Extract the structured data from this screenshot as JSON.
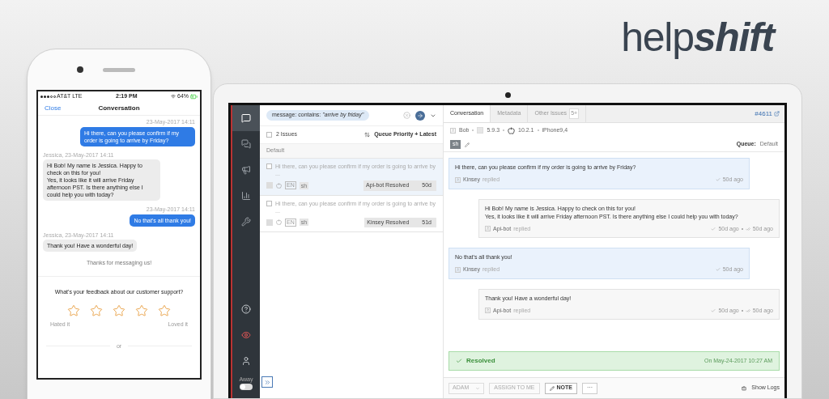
{
  "brand": {
    "logo_light": "help",
    "logo_bold": "shift"
  },
  "phone": {
    "status_bar": {
      "carrier": "AT&T  LTE",
      "time": "2:19 PM",
      "battery": "64%"
    },
    "nav": {
      "close": "Close",
      "title": "Conversation"
    },
    "messages": [
      {
        "kind": "sent",
        "meta": "23-May-2017 14:11",
        "text": "Hi there, can you please confirm if my order is going to arrive by Friday?"
      },
      {
        "kind": "received",
        "meta": "Jessica, 23-May-2017 14:11",
        "text": "Hi Bob! My name is Jessica. Happy to check on this for you!\nYes, it looks like it will arrive Friday afternoon PST.  Is there anything else I could help you with today?"
      },
      {
        "kind": "sent",
        "meta": "23-May-2017 14:11",
        "text": "No that's all thank you!"
      },
      {
        "kind": "received",
        "meta": "Jessica, 23-May-2017 14:11",
        "text": "Thank you! Have a wonderful day!"
      }
    ],
    "footer_note": "Thanks for messaging us!",
    "feedback": {
      "question": "What's your feedback about our customer support?",
      "stars": 0,
      "low_label": "Hated it",
      "high_label": "Loved it"
    },
    "divider_text": "or"
  },
  "app": {
    "sidebar": {
      "top_items": [
        {
          "selected": true
        },
        {
          "selected": false
        },
        {
          "selected": false
        },
        {
          "selected": false
        },
        {
          "selected": false
        }
      ],
      "bottom_items": [
        {
          "alert": false
        },
        {
          "alert": true
        },
        {
          "alert": false
        }
      ],
      "away": {
        "label": "Away",
        "on": false
      }
    },
    "list": {
      "select_all_checked": false,
      "search": "message: contains: *\"arrive by friday\"*",
      "count": "2 Issues",
      "sort": "Queue Priority + Latest",
      "group": "Default",
      "issues": [
        {
          "title": "Hi there, can you please confirm if my order is going to arrive by ...",
          "lang": "EN",
          "tag": "sh",
          "status": "Api-bot Resolved",
          "age": "50d",
          "selected": true
        },
        {
          "title": "Hi there, can you please confirm if my order is going to arrive by ...",
          "lang": "EN",
          "tag": "sh",
          "status": "Kinsey Resolved",
          "age": "51d",
          "selected": false
        }
      ]
    },
    "conversation": {
      "tabs": [
        {
          "label": "Conversation",
          "selected": true
        },
        {
          "label": "Metadata",
          "selected": false
        },
        {
          "label": "Other Issues",
          "badge": "5+",
          "selected": false
        }
      ],
      "issue_id": "#4611",
      "user": "Bob",
      "app_version": "5.9.3",
      "os_version": "10.2.1",
      "device": "iPhone9,4",
      "tag": "sh",
      "queue_label": "Queue:",
      "queue": "Default",
      "messages": [
        {
          "kind": "customer",
          "lines": [
            "Hi there, can you please confirm if my order is going to arrive by Friday?"
          ],
          "author": "Kinsey",
          "action": "replied",
          "time": "50d ago"
        },
        {
          "kind": "agent",
          "lines": [
            "Hi Bob! My name is Jessica. Happy to check on this for you!",
            "Yes, it looks like it will arrive Friday afternoon PST. Is there anything else I could help you with today?"
          ],
          "author": "Api-bot",
          "action": "replied",
          "time": "50d ago",
          "read_time": "50d ago"
        },
        {
          "kind": "customer",
          "lines": [
            "No that's all thank you!"
          ],
          "author": "Kinsey",
          "action": "replied",
          "time": "50d ago"
        },
        {
          "kind": "agent",
          "lines": [
            "Thank you! Have a wonderful day!"
          ],
          "author": "Api-bot",
          "action": "replied",
          "time": "50d ago",
          "read_time": "50d ago"
        }
      ],
      "resolved": {
        "label": "Resolved",
        "time": "On May-24-2017 10:27 AM"
      },
      "footer": {
        "assignee": "ADAM",
        "assign": "ASSIGN TO ME",
        "note": "NOTE",
        "more": "···",
        "logs": "Show Logs"
      }
    }
  }
}
